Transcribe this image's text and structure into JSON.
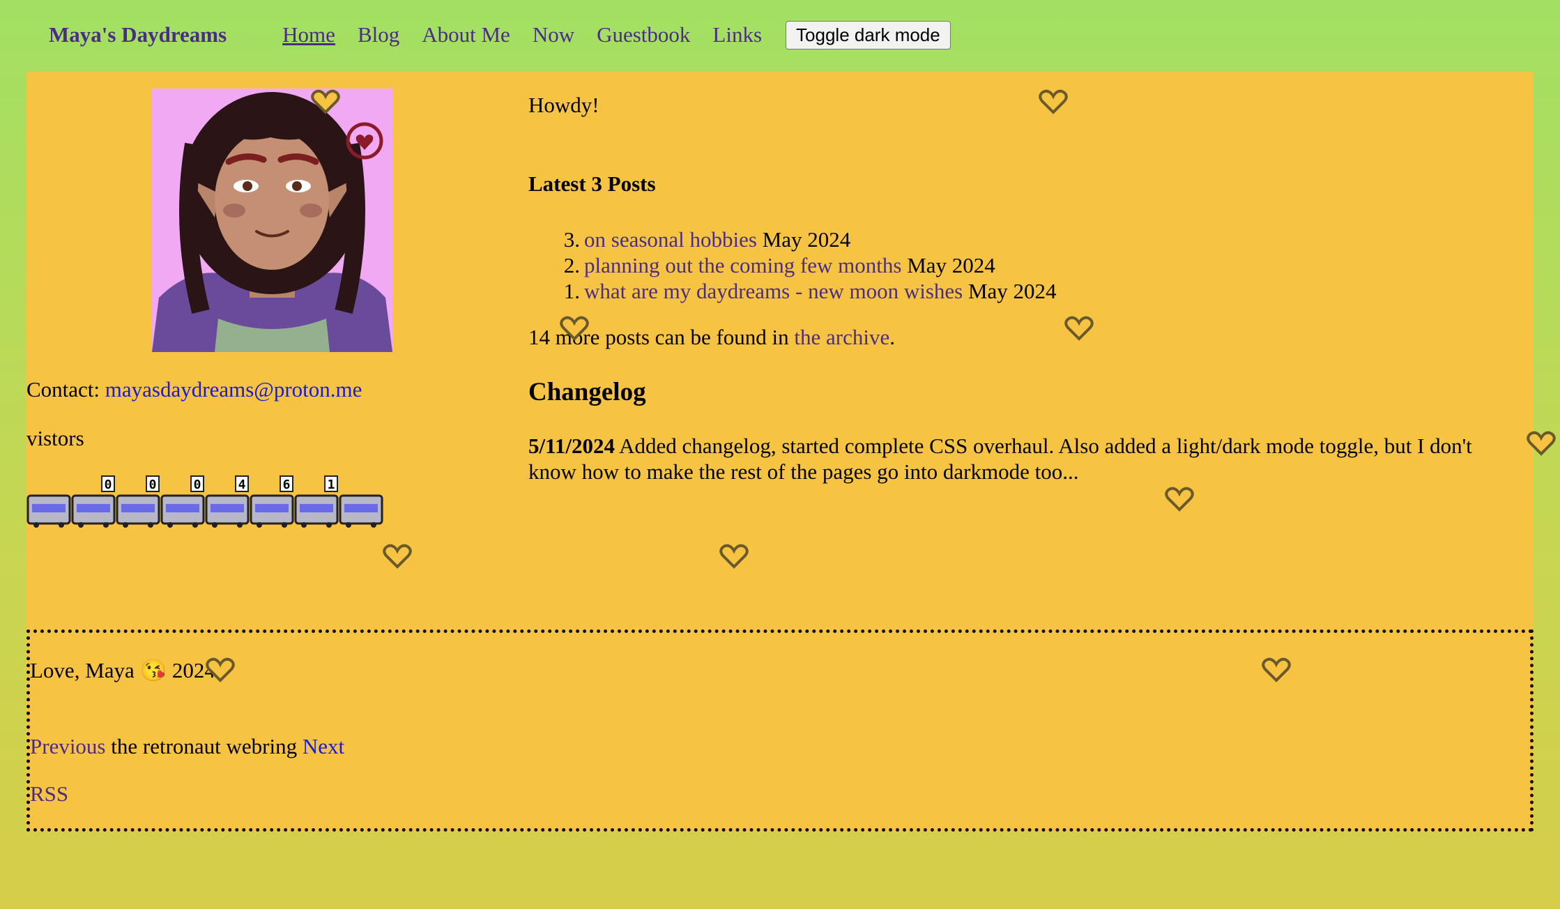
{
  "nav": {
    "site_title": "Maya's Daydreams",
    "links": [
      {
        "label": "Home",
        "current": true
      },
      {
        "label": "Blog"
      },
      {
        "label": "About Me"
      },
      {
        "label": "Now"
      },
      {
        "label": "Guestbook"
      },
      {
        "label": "Links"
      }
    ],
    "toggle_label": "Toggle dark mode"
  },
  "sidebar": {
    "contact_label": "Contact:",
    "contact_email": "mayasdaydreams@proton.me",
    "visitors_label": "vistors",
    "visitor_digits": [
      "0",
      "0",
      "0",
      "4",
      "6",
      "1"
    ]
  },
  "main": {
    "greeting": "Howdy!",
    "posts_heading": "Latest 3 Posts",
    "posts": [
      {
        "num": "3.",
        "title": "on seasonal hobbies",
        "date": "May 2024"
      },
      {
        "num": "2.",
        "title": "planning out the coming few months",
        "date": "May 2024"
      },
      {
        "num": "1.",
        "title": "what are my daydreams - new moon wishes",
        "date": "May 2024"
      }
    ],
    "archive_prefix": "14 more posts can be found in",
    "archive_link": "the archive",
    "archive_suffix": ".",
    "changelog_heading": "Changelog",
    "changelog": [
      {
        "date": "5/11/2024",
        "text": "Added changelog, started complete CSS overhaul. Also added a light/dark mode toggle, but I don't know how to make the rest of the pages go into darkmode too..."
      }
    ]
  },
  "footer": {
    "signoff": "Love, Maya 😘 2024",
    "webring_prev": "Previous",
    "webring_name": "the retronaut webring",
    "webring_next": "Next",
    "rss": "RSS"
  },
  "colors": {
    "background_top": "#a2e063",
    "panel": "#f7c342",
    "link_purple": "#4b2e83",
    "link_blue": "#1a1ad8"
  }
}
